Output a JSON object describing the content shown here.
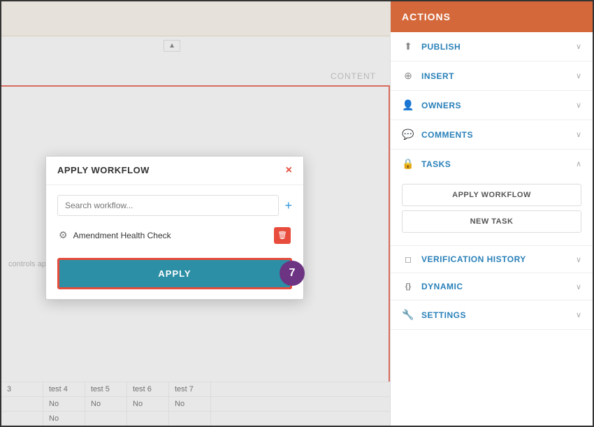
{
  "sidebar": {
    "header": "ACTIONS",
    "items": [
      {
        "id": "publish",
        "label": "PUBLISH",
        "icon": "↑",
        "chevron": "∨"
      },
      {
        "id": "insert",
        "label": "INSERT",
        "icon": "⊕",
        "chevron": "∨"
      },
      {
        "id": "owners",
        "label": "OWNERS",
        "icon": "👥",
        "chevron": "∨"
      },
      {
        "id": "comments",
        "label": "COMMENTS",
        "icon": "💬",
        "chevron": "∨"
      },
      {
        "id": "tasks",
        "label": "TASKS",
        "icon": "🔒",
        "chevron": "∧"
      }
    ],
    "tasks_buttons": [
      "APPLY WORKFLOW",
      "NEW TASK"
    ],
    "other_items": [
      {
        "id": "verification-history",
        "label": "VERIFICATION HISTORY",
        "icon": "",
        "chevron": "∨"
      },
      {
        "id": "dynamic",
        "label": "DYNAMIC",
        "icon": "{}",
        "chevron": "∨"
      },
      {
        "id": "settings",
        "label": "SETTINGS",
        "icon": "🔧",
        "chevron": "∨"
      }
    ]
  },
  "modal": {
    "title": "APPLY WORKFLOW",
    "close_label": "×",
    "search_placeholder": "Search workflow...",
    "add_label": "+",
    "workflow_item": "Amendment Health Check",
    "apply_label": "APPLY",
    "badge": "7"
  },
  "content": {
    "label": "CONTENT",
    "controls_text": "controls apply?",
    "table": {
      "rows": [
        [
          "3",
          "test 4",
          "test 5",
          "test 6",
          "test 7"
        ],
        [
          "",
          "No",
          "No",
          "No",
          "No"
        ],
        [
          "",
          "No",
          "",
          "",
          ""
        ]
      ]
    }
  }
}
